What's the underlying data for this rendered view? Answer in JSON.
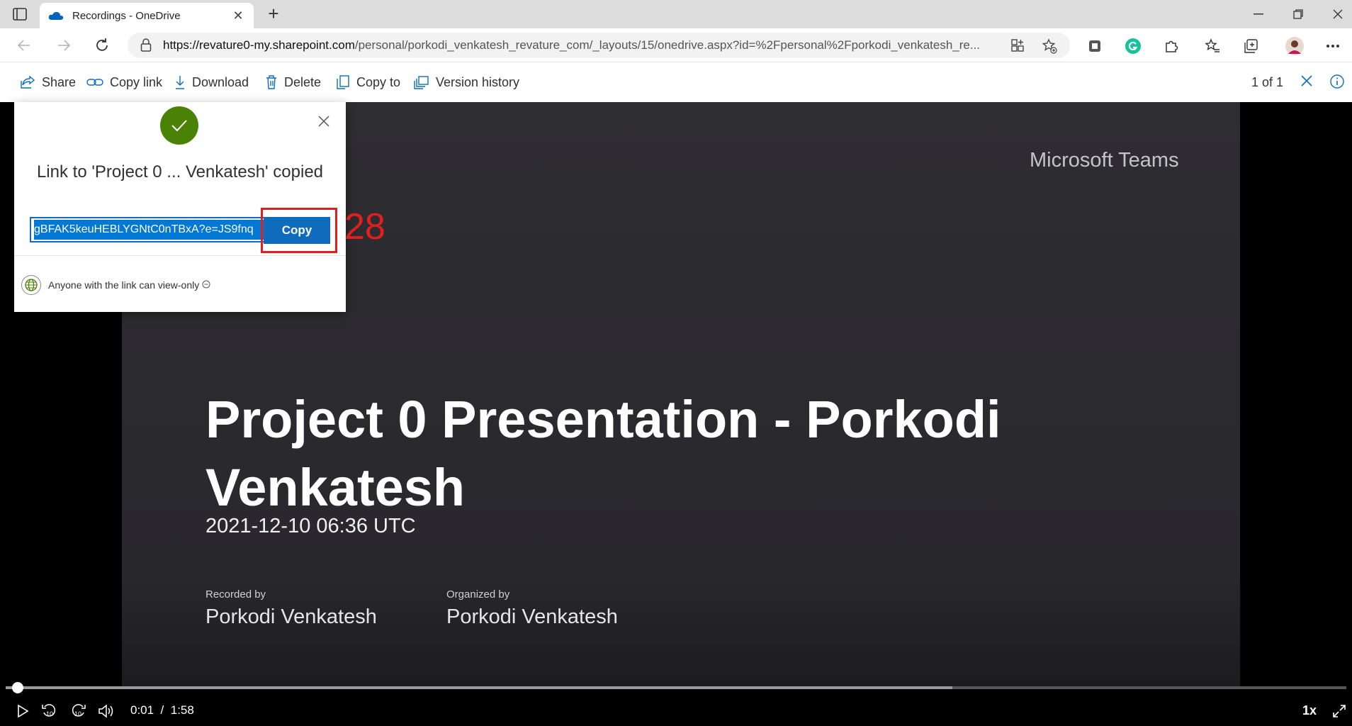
{
  "browser": {
    "tab_title": "Recordings - OneDrive",
    "url_domain": "https://revature0-my.sharepoint.com",
    "url_path": "/personal/porkodi_venkatesh_revature_com/_layouts/15/onedrive.aspx?id=%2Fpersonal%2Fporkodi_venkatesh_re..."
  },
  "commands": {
    "share": "Share",
    "copy_link": "Copy link",
    "download": "Download",
    "delete": "Delete",
    "copy_to": "Copy to",
    "version_history": "Version history",
    "pager": "1 of 1"
  },
  "dialog": {
    "message": "Link to 'Project 0 ... Venkatesh' copied",
    "link_value": "gBFAK5keuHEBLYGNtC0nTBxA?e=JS9fnq",
    "copy_button": "Copy",
    "permission": "Anyone with the link can view-only",
    "annotation_number": "28"
  },
  "video": {
    "brand": "Microsoft Teams",
    "title": "Project 0 Presentation - Porkodi Venkatesh",
    "date": "2021-12-10 06:36 UTC",
    "recorded_by_label": "Recorded by",
    "recorded_by": "Porkodi Venkatesh",
    "organized_by_label": "Organized by",
    "organized_by": "Porkodi Venkatesh",
    "current_time": "0:01",
    "separator": "/",
    "duration": "1:58",
    "speed": "1x",
    "played_fraction": 0.009,
    "buffered_fraction": 0.706,
    "skip_seconds": "10"
  },
  "colors": {
    "accent": "#0f6cbd",
    "success": "#498205",
    "annotation": "#e02020"
  }
}
